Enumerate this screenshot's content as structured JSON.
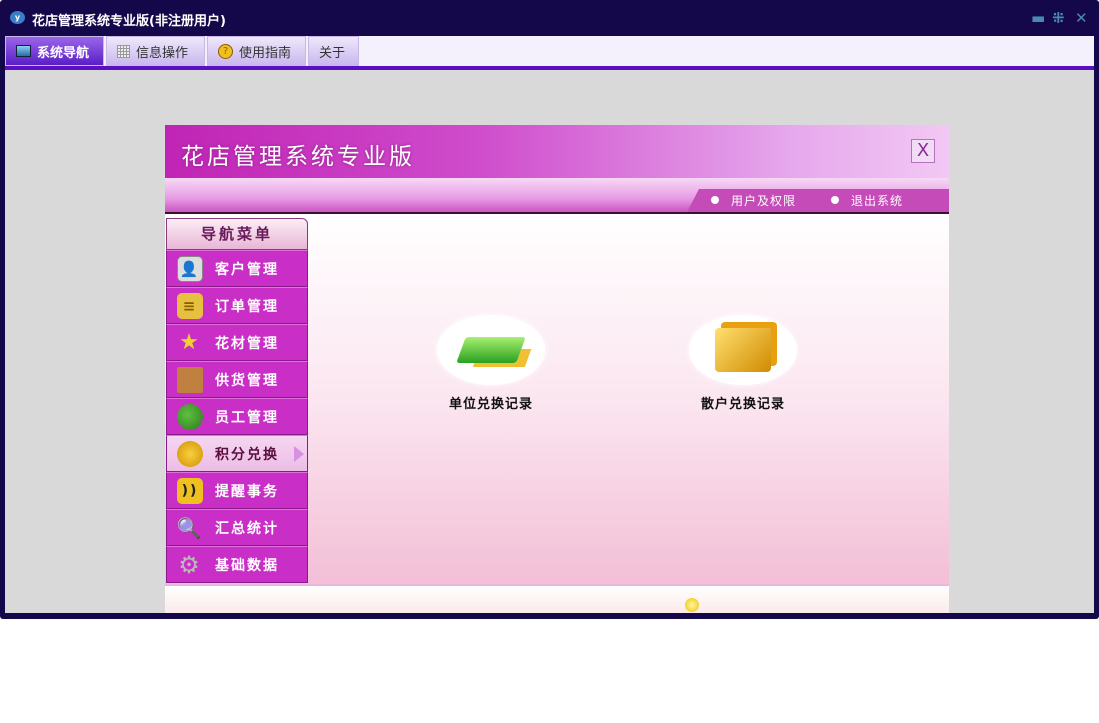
{
  "window": {
    "title": "花店管理系统专业版(非注册用户)",
    "app_icon": "y"
  },
  "tabs": [
    {
      "label": "系统导航",
      "icon": "monitor-icon"
    },
    {
      "label": "信息操作",
      "icon": "grid-icon"
    },
    {
      "label": "使用指南",
      "icon": "help-icon"
    },
    {
      "label": "关于"
    }
  ],
  "panel": {
    "title": "花店管理系统专业版",
    "close": "X",
    "links": [
      "用户及权限",
      "退出系统"
    ]
  },
  "nav": {
    "header": "导航菜单",
    "items": [
      {
        "label": "客户管理",
        "icon": "contact-card-icon"
      },
      {
        "label": "订单管理",
        "icon": "scroll-icon"
      },
      {
        "label": "花材管理",
        "icon": "star-icon"
      },
      {
        "label": "供货管理",
        "icon": "crate-icon"
      },
      {
        "label": "员工管理",
        "icon": "users-icon"
      },
      {
        "label": "积分兑换",
        "icon": "coins-icon",
        "active": true
      },
      {
        "label": "提醒事务",
        "icon": "rss-icon"
      },
      {
        "label": "汇总统计",
        "icon": "magnifier-icon"
      },
      {
        "label": "基础数据",
        "icon": "gear-icon"
      }
    ]
  },
  "main": {
    "actions": [
      {
        "label": "单位兑换记录",
        "icon": "money-stack-icon"
      },
      {
        "label": "散户兑换记录",
        "icon": "coin-cards-icon"
      }
    ]
  }
}
